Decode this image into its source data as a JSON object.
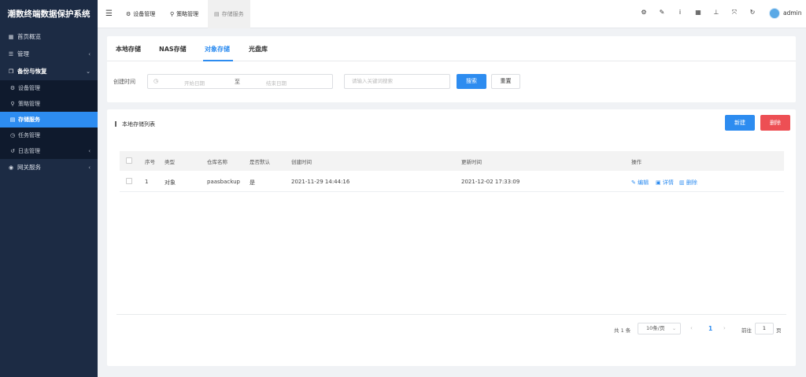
{
  "app_title": "潮数终端数据保护系统",
  "sidebar": {
    "items": [
      {
        "label": "首页概览",
        "icon": "chart-icon"
      },
      {
        "label": "管理",
        "icon": "list-icon"
      },
      {
        "label": "备份与恢复",
        "icon": "copy-icon"
      },
      {
        "label": "网关服务",
        "icon": "eye-icon"
      }
    ],
    "subitems": [
      {
        "label": "设备管理",
        "icon": "cog-icon"
      },
      {
        "label": "策略管理",
        "icon": "magic-icon"
      },
      {
        "label": "存储服务",
        "icon": "database-icon"
      },
      {
        "label": "任务管理",
        "icon": "clock-icon"
      },
      {
        "label": "日志管理",
        "icon": "history-icon"
      }
    ]
  },
  "topbar": {
    "tabs": [
      {
        "label": "设备管理",
        "icon": "cogs-icon"
      },
      {
        "label": "策略管理",
        "icon": "magic-icon"
      },
      {
        "label": "存储服务",
        "icon": "database-icon"
      }
    ],
    "tools": [
      "gear-icon",
      "wrench-icon",
      "info-icon",
      "grid-icon",
      "pin-icon",
      "fullscreen-icon",
      "refresh-icon"
    ],
    "user": "admin"
  },
  "storage_tabs": [
    "本地存储",
    "NAS存储",
    "对象存储",
    "光盘库"
  ],
  "filter": {
    "label": "创建时间",
    "start_placeholder": "开始日期",
    "separator": "至",
    "end_placeholder": "结束日期",
    "keyword_placeholder": "请输入关键词搜索",
    "search_label": "搜索",
    "reset_label": "重置"
  },
  "list": {
    "title": "本地存储列表",
    "new_label": "新建",
    "delete_label": "删除",
    "columns": [
      "序号",
      "类型",
      "仓库名称",
      "是否默认",
      "创建时间",
      "更新时间",
      "操作"
    ],
    "rows": [
      {
        "index": "1",
        "type": "对象",
        "name": "paasbackup",
        "default": "是",
        "created": "2021-11-29 14:44:16",
        "updated": "2021-12-02 17:33:09"
      }
    ],
    "actions": {
      "edit": "编辑",
      "detail": "详情",
      "delete": "删除"
    }
  },
  "pagination": {
    "total": "共 1 条",
    "page_size": "10条/页",
    "current": "1",
    "goto_label": "前往",
    "goto_value": "1",
    "unit": "页"
  }
}
